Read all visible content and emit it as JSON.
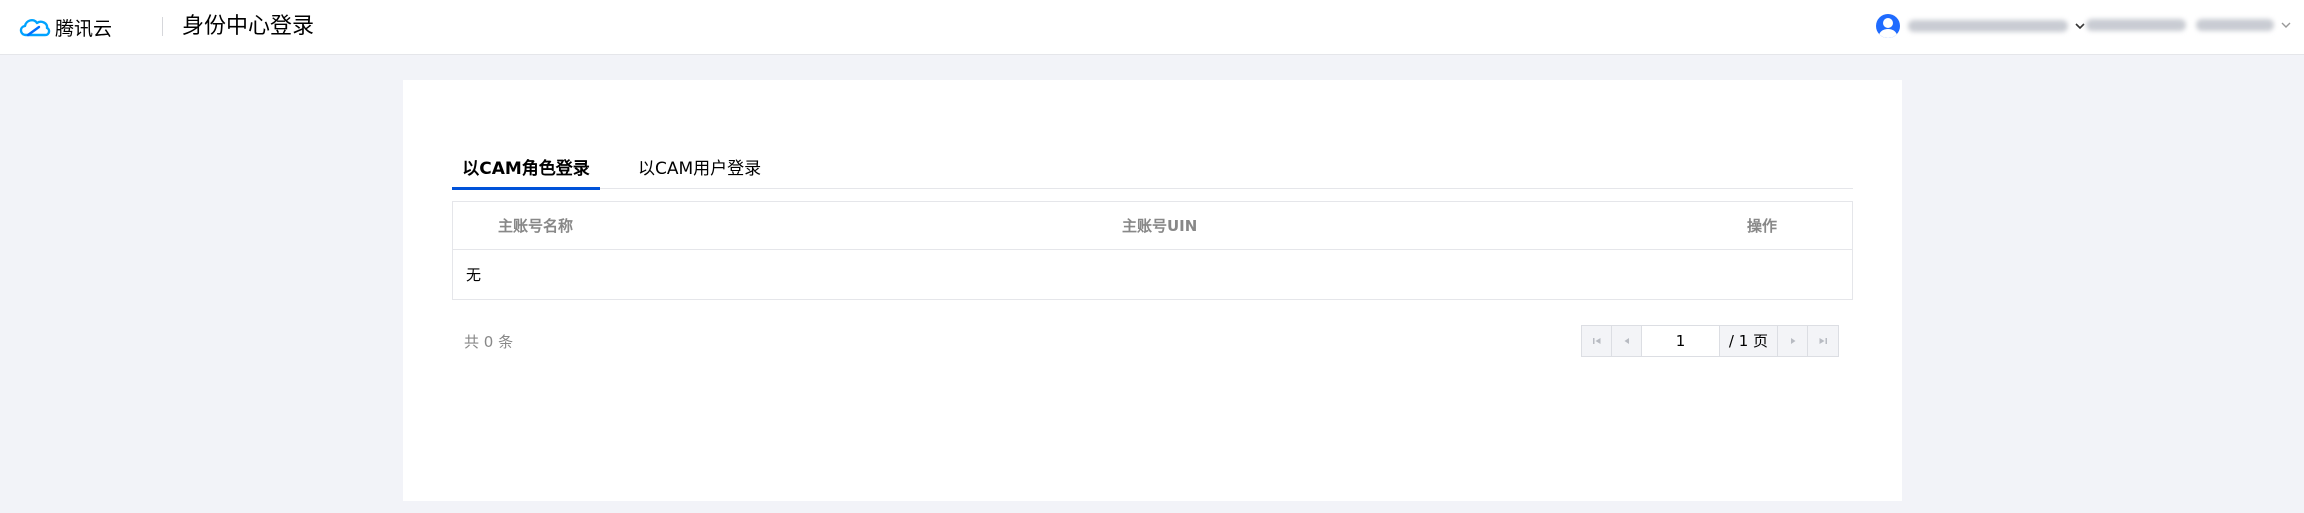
{
  "header": {
    "logo_text": "腾讯云",
    "page_title": "身份中心登录",
    "account_name_blurred": true,
    "region_blurred": true
  },
  "tabs": [
    {
      "label": "以CAM角色登录",
      "active": true
    },
    {
      "label": "以CAM用户登录",
      "active": false
    }
  ],
  "table": {
    "columns": [
      "主账号名称",
      "主账号UIN",
      "操作"
    ],
    "empty_text": "无"
  },
  "footer": {
    "total_text": "共 0 条"
  },
  "pagination": {
    "current_page": "1",
    "total_pages_text": "/ 1 页"
  },
  "colors": {
    "accent": "#0052d9",
    "avatar": "#1f6bff",
    "page_bg": "#f2f3f8"
  }
}
